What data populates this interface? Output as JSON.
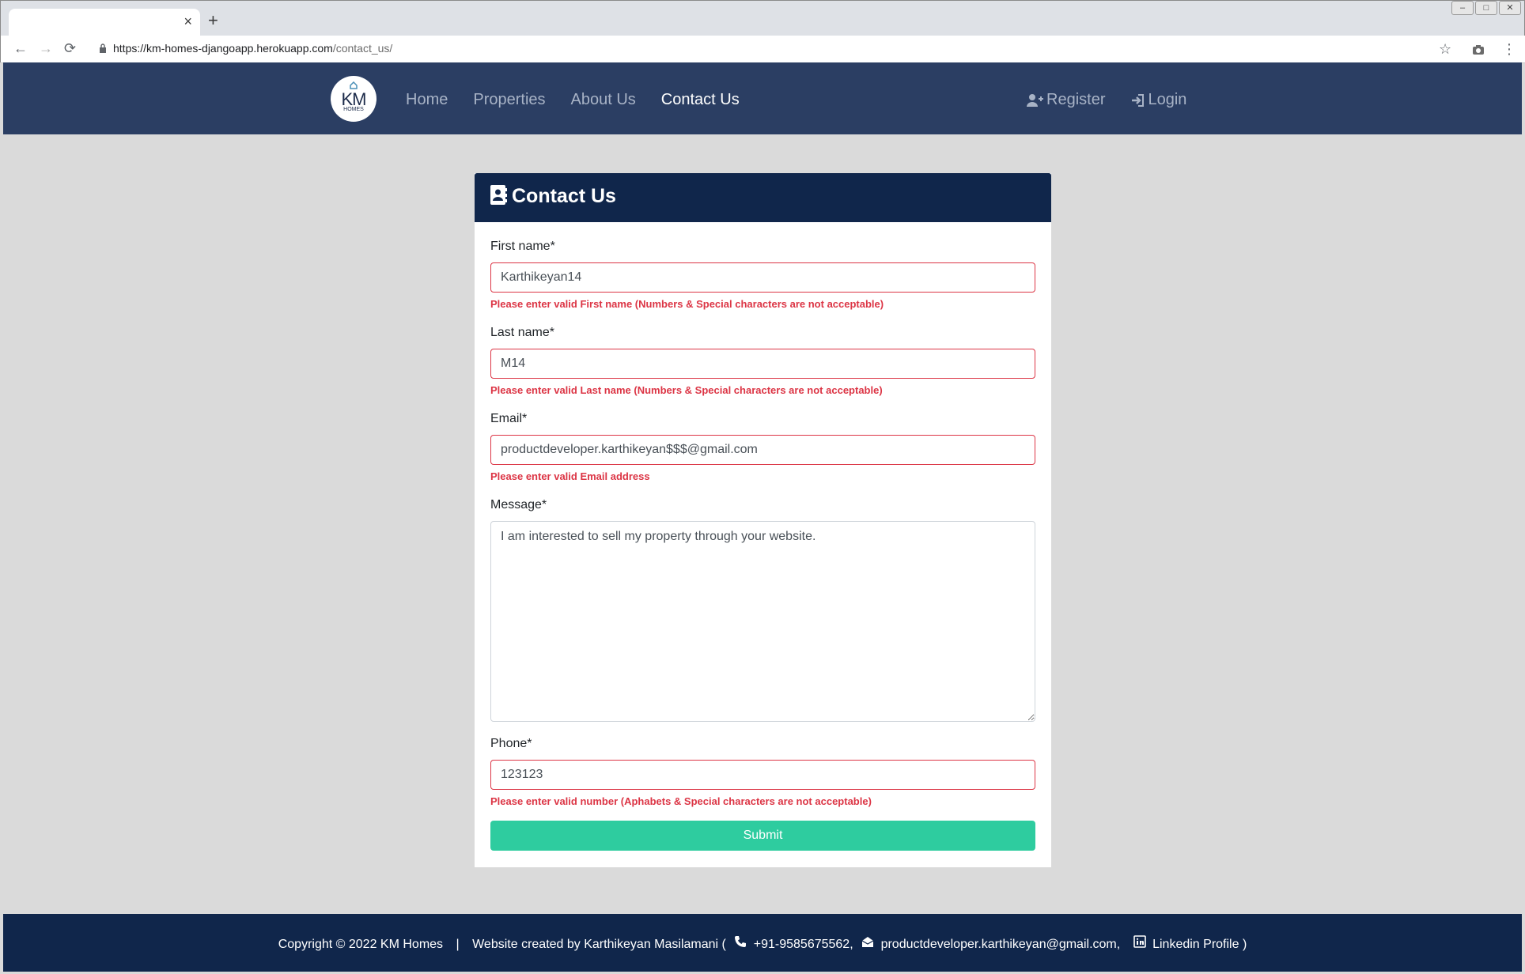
{
  "browser": {
    "tab_close": "×",
    "new_tab": "+",
    "url_host": "https://km-homes-djangoapp.herokuapp.com",
    "url_path": "/contact_us/",
    "back": "←",
    "forward": "→",
    "reload": "⟳",
    "star": "☆",
    "menu": "⋮"
  },
  "navbar": {
    "logo_text": "KM",
    "logo_sub": "HOMES",
    "links": [
      "Home",
      "Properties",
      "About Us",
      "Contact Us"
    ],
    "active": "Contact Us",
    "register": "Register",
    "login": "Login"
  },
  "form": {
    "title": "Contact Us",
    "first_name": {
      "label": "First name*",
      "value": "Karthikeyan14",
      "error": "Please enter valid First name (Numbers & Special characters are not acceptable)"
    },
    "last_name": {
      "label": "Last name*",
      "value": "M14",
      "error": "Please enter valid Last name (Numbers & Special characters are not acceptable)"
    },
    "email": {
      "label": "Email*",
      "value": "productdeveloper.karthikeyan$$$@gmail.com",
      "error": "Please enter valid Email address"
    },
    "message": {
      "label": "Message*",
      "value": "I am interested to sell my property through your website."
    },
    "phone": {
      "label": "Phone*",
      "value": "123123",
      "error": "Please enter valid number (Aphabets & Special characters are not acceptable)"
    },
    "submit": "Submit"
  },
  "footer": {
    "copyright": "Copyright © 2022 KM Homes",
    "separator": "|",
    "created_by": "Website created by Karthikeyan Masilamani (",
    "phone": "+91-9585675562,",
    "email": "productdeveloper.karthikeyan@gmail.com,",
    "linkedin": "Linkedin Profile )"
  },
  "colors": {
    "navbar": "#2b3e63",
    "header": "#10264b",
    "error": "#dc3545",
    "submit": "#2ecc9f"
  }
}
